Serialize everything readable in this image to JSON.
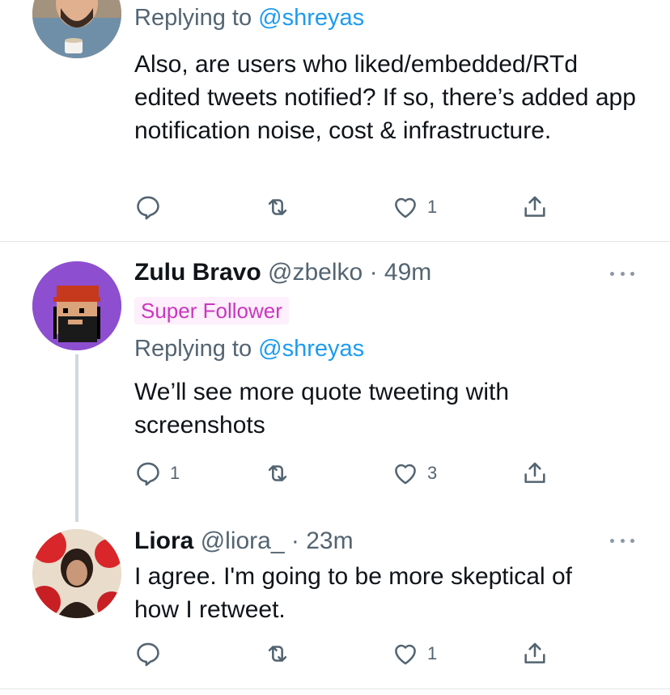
{
  "tweets": [
    {
      "replying_prefix": "Replying to",
      "replying_handle": "@shreyas",
      "text": "Also, are users who liked/embedded/RTd edited tweets notified? If so, there’s added app notification noise, cost & infrastructure.",
      "actions": {
        "reply_count": "",
        "retweet_count": "",
        "like_count": "1"
      }
    },
    {
      "name": "Zulu Bravo",
      "handle": "@zbelko",
      "time": "· 49m",
      "badge": "Super Follower",
      "replying_prefix": "Replying to",
      "replying_handle": "@shreyas",
      "text": "We’ll see more quote tweeting with screenshots",
      "actions": {
        "reply_count": "1",
        "retweet_count": "",
        "like_count": "3"
      }
    },
    {
      "name": "Liora",
      "handle": "@liora_",
      "time": "· 23m",
      "text": "I agree. I'm going to be more skeptical of how I retweet.",
      "actions": {
        "reply_count": "",
        "retweet_count": "",
        "like_count": "1"
      }
    }
  ],
  "colors": {
    "accent": "#1d9bf0",
    "secondary_text": "#536471",
    "badge_bg": "#fdeffb",
    "badge_text": "#c937c0",
    "icon": "#536471"
  },
  "icons": [
    "reply-icon",
    "retweet-icon",
    "like-icon",
    "share-icon",
    "more-options-icon"
  ]
}
